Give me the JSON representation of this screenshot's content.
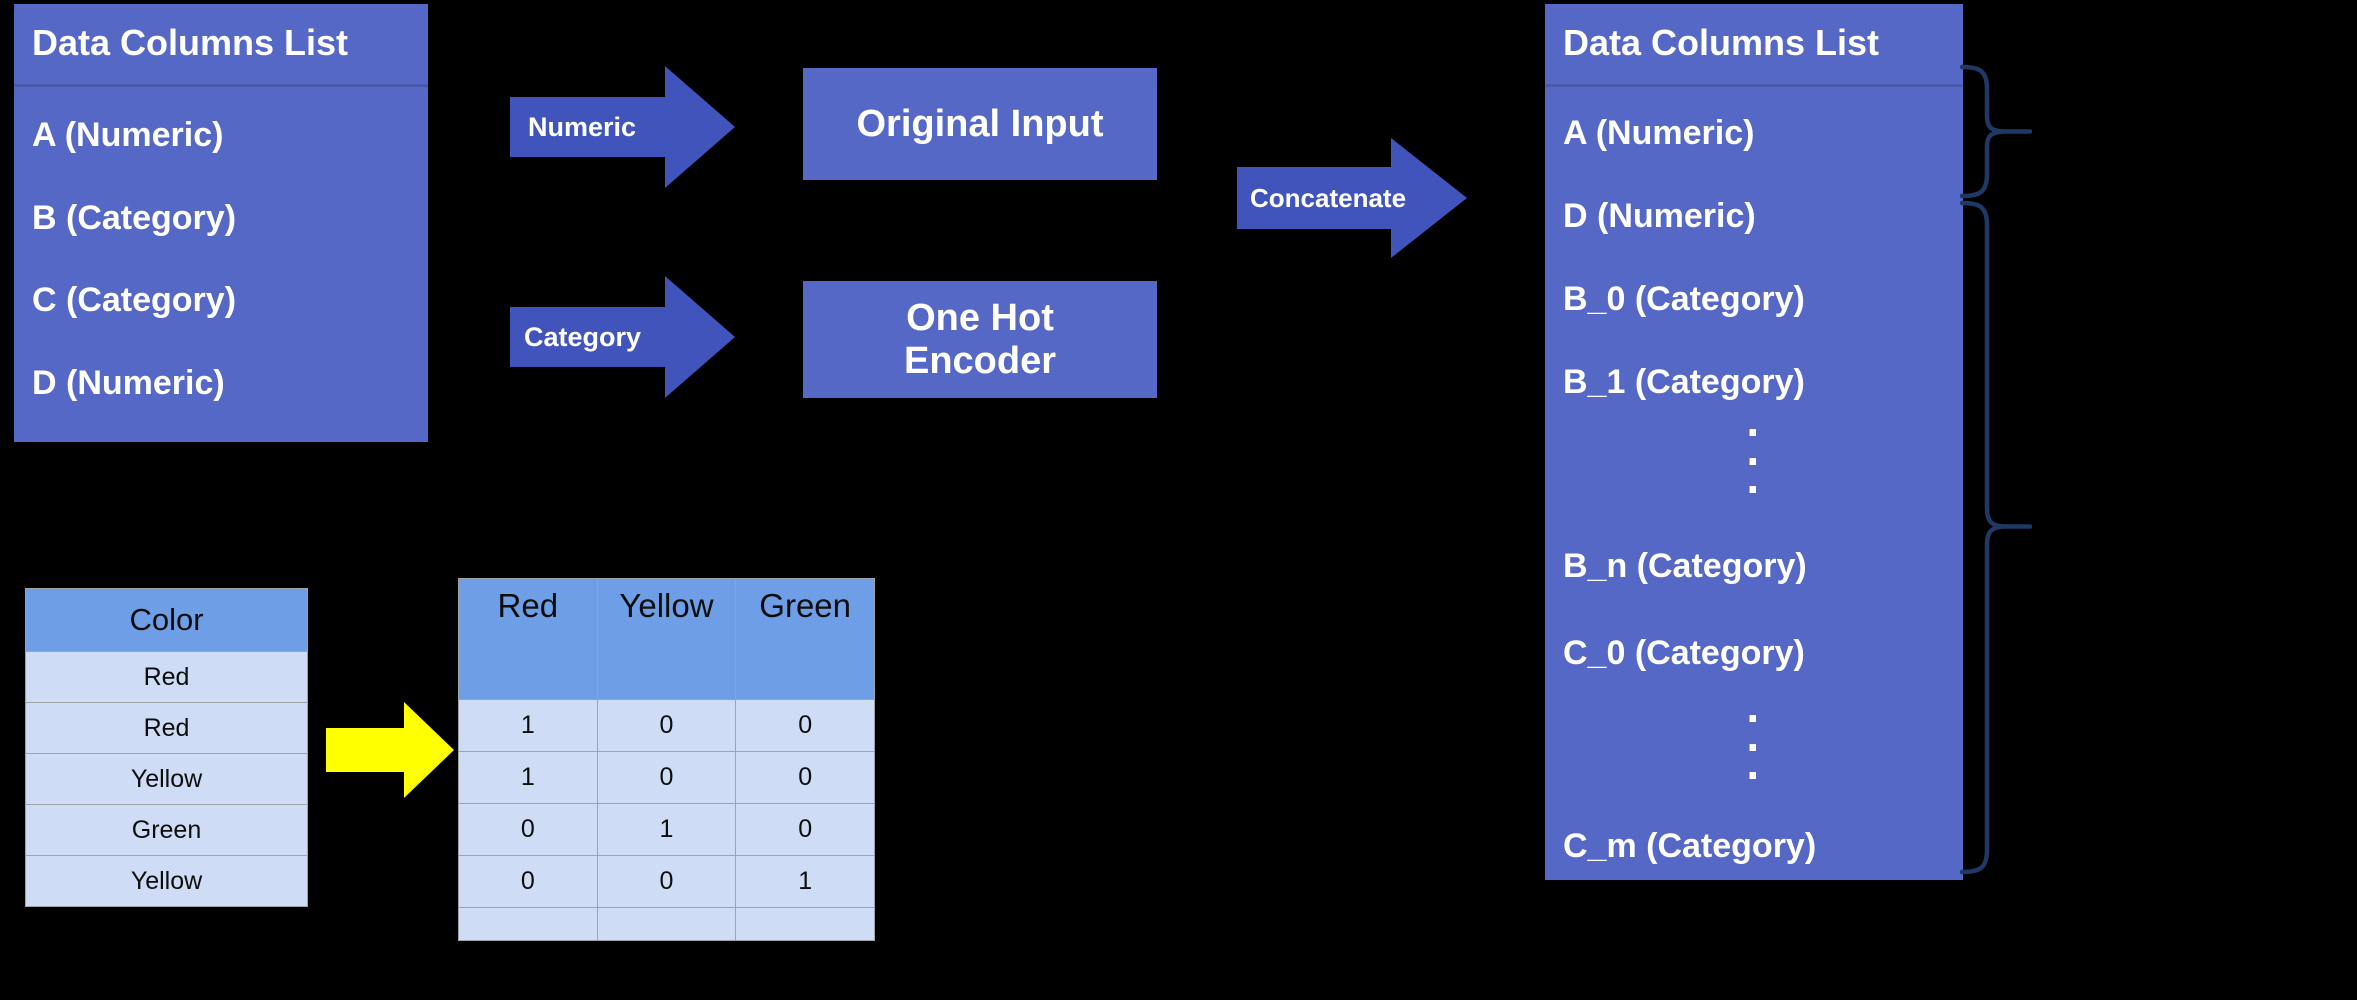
{
  "colors": {
    "background": "#000000",
    "panel_blue": "#5668c6",
    "panel_divider": "#4a59ad",
    "arrow_blue": "#4054bb",
    "brace_navy": "#1f3864",
    "table_header_blue": "#6e9ee5",
    "table_cell_blue": "#cfdcf5",
    "table_border_gray": "#9fa3a8",
    "yellow_arrow": "#ffff00",
    "text_white": "#ffffff",
    "text_black": "#0d0d0d"
  },
  "left_panel": {
    "title": "Data Columns List",
    "items": [
      "A (Numeric)",
      "B (Category)",
      "C (Category)",
      "D (Numeric)"
    ]
  },
  "arrows": {
    "numeric": "Numeric",
    "category": "Category",
    "concatenate": "Concatenate"
  },
  "process_boxes": {
    "original_input": "Original Input",
    "one_hot_encoder": "One Hot\nEncoder"
  },
  "right_panel": {
    "title": "Data Columns List",
    "items": [
      "A (Numeric)",
      "D (Numeric)",
      "B_0 (Category)",
      "B_1 (Category)",
      "B_n (Category)",
      "C_0 (Category)",
      "C_m (Category)"
    ],
    "ellipsis": "·\n·\n·",
    "braces": [
      {
        "name": "numeric-group-brace",
        "spans": [
          "A (Numeric)",
          "D (Numeric)"
        ]
      },
      {
        "name": "category-group-brace",
        "spans": [
          "B_0 (Category)",
          "C_m (Category)"
        ]
      }
    ]
  },
  "example": {
    "yellow_arrow_icon": "right-arrow-icon",
    "source_table": {
      "header": "Color",
      "rows": [
        "Red",
        "Red",
        "Yellow",
        "Green",
        "Yellow"
      ]
    },
    "encoded_table": {
      "headers": [
        "Red",
        "Yellow",
        "Green"
      ],
      "rows": [
        [
          "1",
          "0",
          "0"
        ],
        [
          "1",
          "0",
          "0"
        ],
        [
          "0",
          "1",
          "0"
        ],
        [
          "0",
          "0",
          "1"
        ],
        [
          "",
          "",
          ""
        ]
      ]
    }
  }
}
